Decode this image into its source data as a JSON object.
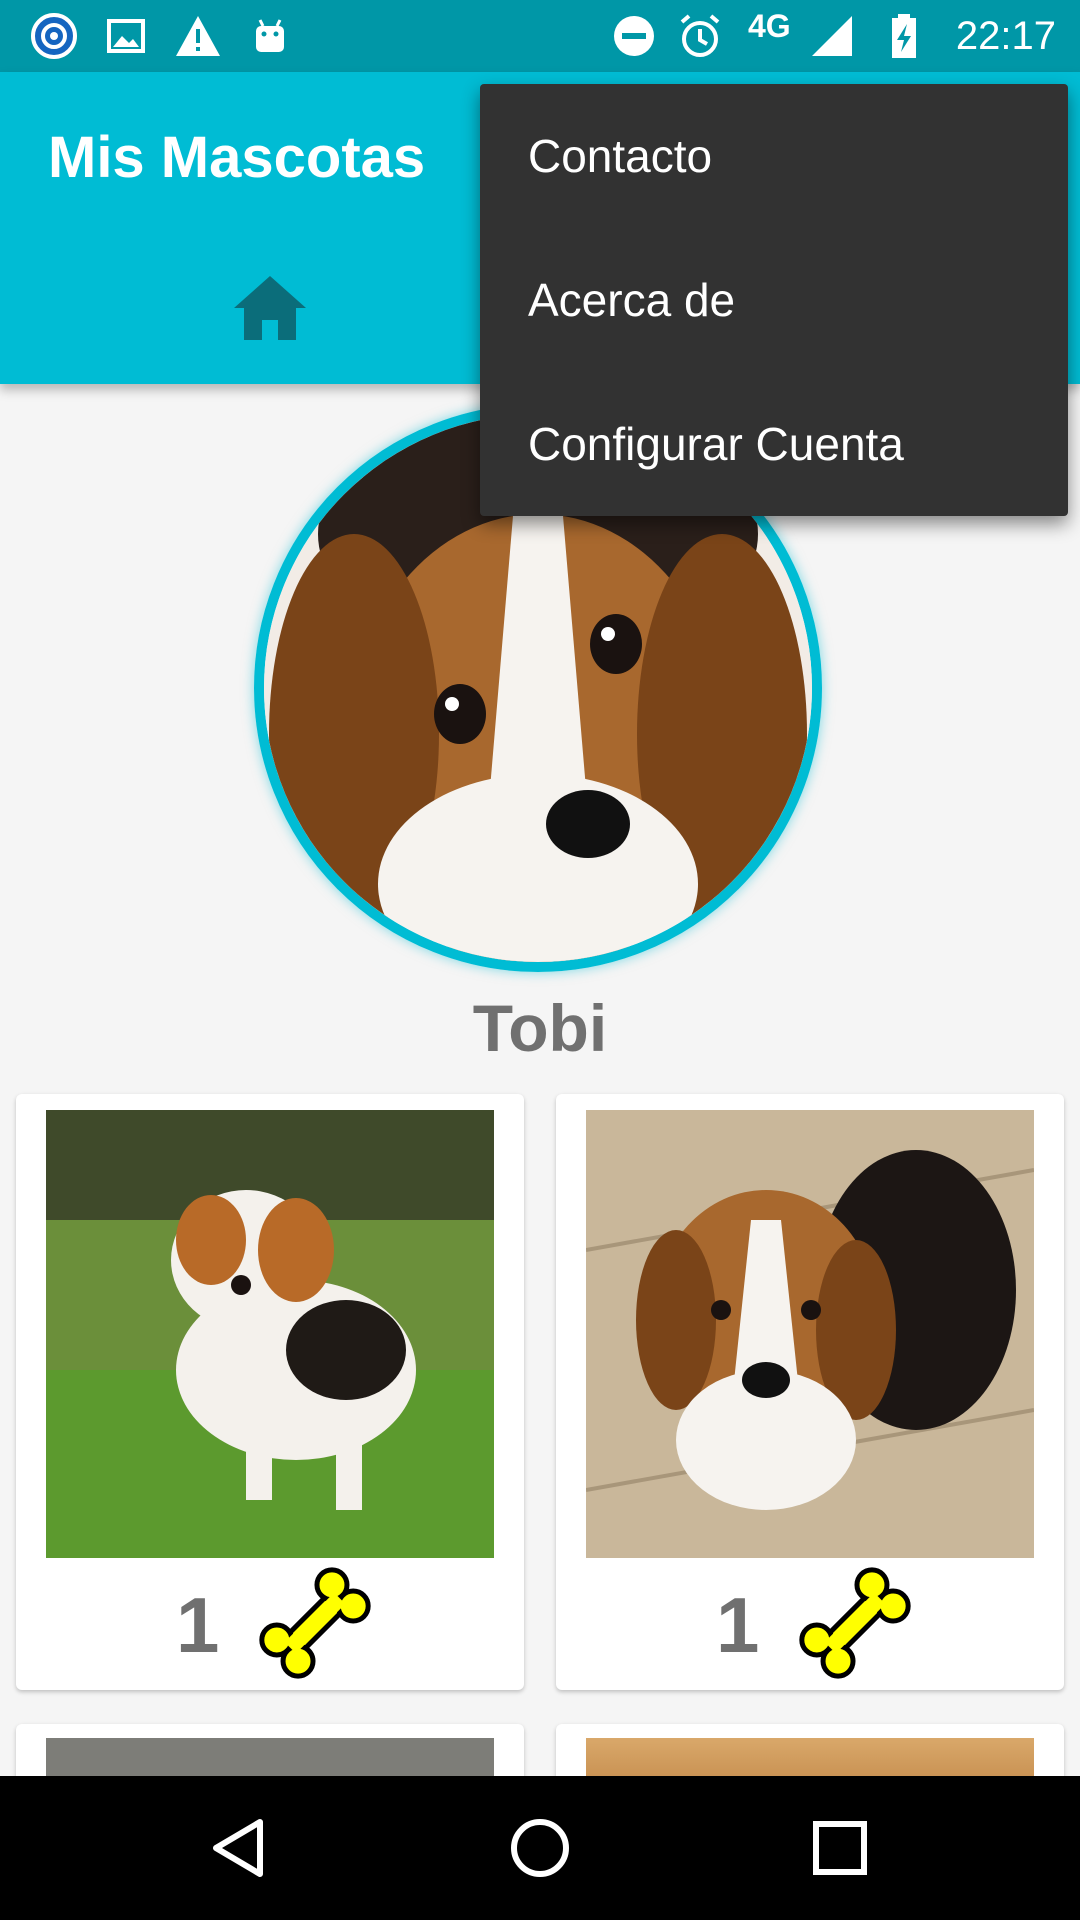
{
  "status_bar": {
    "time": "22:17",
    "network": "4G",
    "icons": [
      "app-notification-icon",
      "image-icon",
      "warning-icon",
      "android-icon",
      "do-not-disturb-icon",
      "alarm-icon",
      "signal-icon",
      "battery-charging-icon"
    ]
  },
  "toolbar": {
    "title": "Mis Mascotas",
    "tab_icon": "home-icon"
  },
  "overflow_menu": {
    "items": [
      {
        "label": "Contacto"
      },
      {
        "label": "Acerca de"
      },
      {
        "label": "Configurar Cuenta"
      }
    ]
  },
  "profile": {
    "pet_name": "Tobi"
  },
  "gallery": {
    "cards": [
      {
        "likes": "1",
        "icon": "bone-icon"
      },
      {
        "likes": "1",
        "icon": "bone-icon"
      }
    ]
  },
  "navigation_bar": {
    "buttons": [
      "back-icon",
      "home-circle-icon",
      "recents-icon"
    ]
  },
  "colors": {
    "primary": "#00bcd4",
    "primary_dark": "#0097a7",
    "menu_background": "#323232",
    "bone": "#ffff00"
  }
}
